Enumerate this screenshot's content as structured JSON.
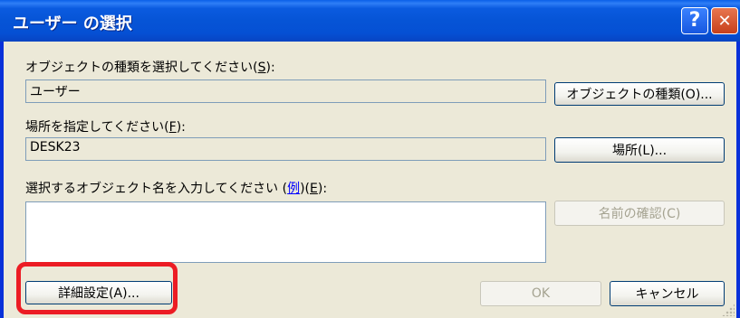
{
  "window": {
    "title": "ユーザー の選択",
    "help_glyph": "?",
    "close_glyph": "✕"
  },
  "object_type": {
    "label": "オブジェクトの種類を選択してください(",
    "accel": "S",
    "label_end": "):",
    "value": "ユーザー",
    "button_label": "オブジェクトの種類(O)..."
  },
  "location": {
    "label": "場所を指定してください(",
    "accel": "F",
    "label_end": "):",
    "value": "DESK23",
    "button_label": "場所(L)..."
  },
  "names": {
    "label_start": "選択するオブジェクト名を入力してください (",
    "example_link": "例",
    "label_mid": ")(",
    "accel": "E",
    "label_end": "):",
    "value": "",
    "check_names_label": "名前の確認(C)"
  },
  "footer": {
    "advanced_label": "詳細設定(A)...",
    "ok_label": "OK",
    "cancel_label": "キャンセル"
  },
  "colors": {
    "highlight": "#ec1c24",
    "titlebar": "#0654d6",
    "dialog_bg": "#ece9d8"
  }
}
